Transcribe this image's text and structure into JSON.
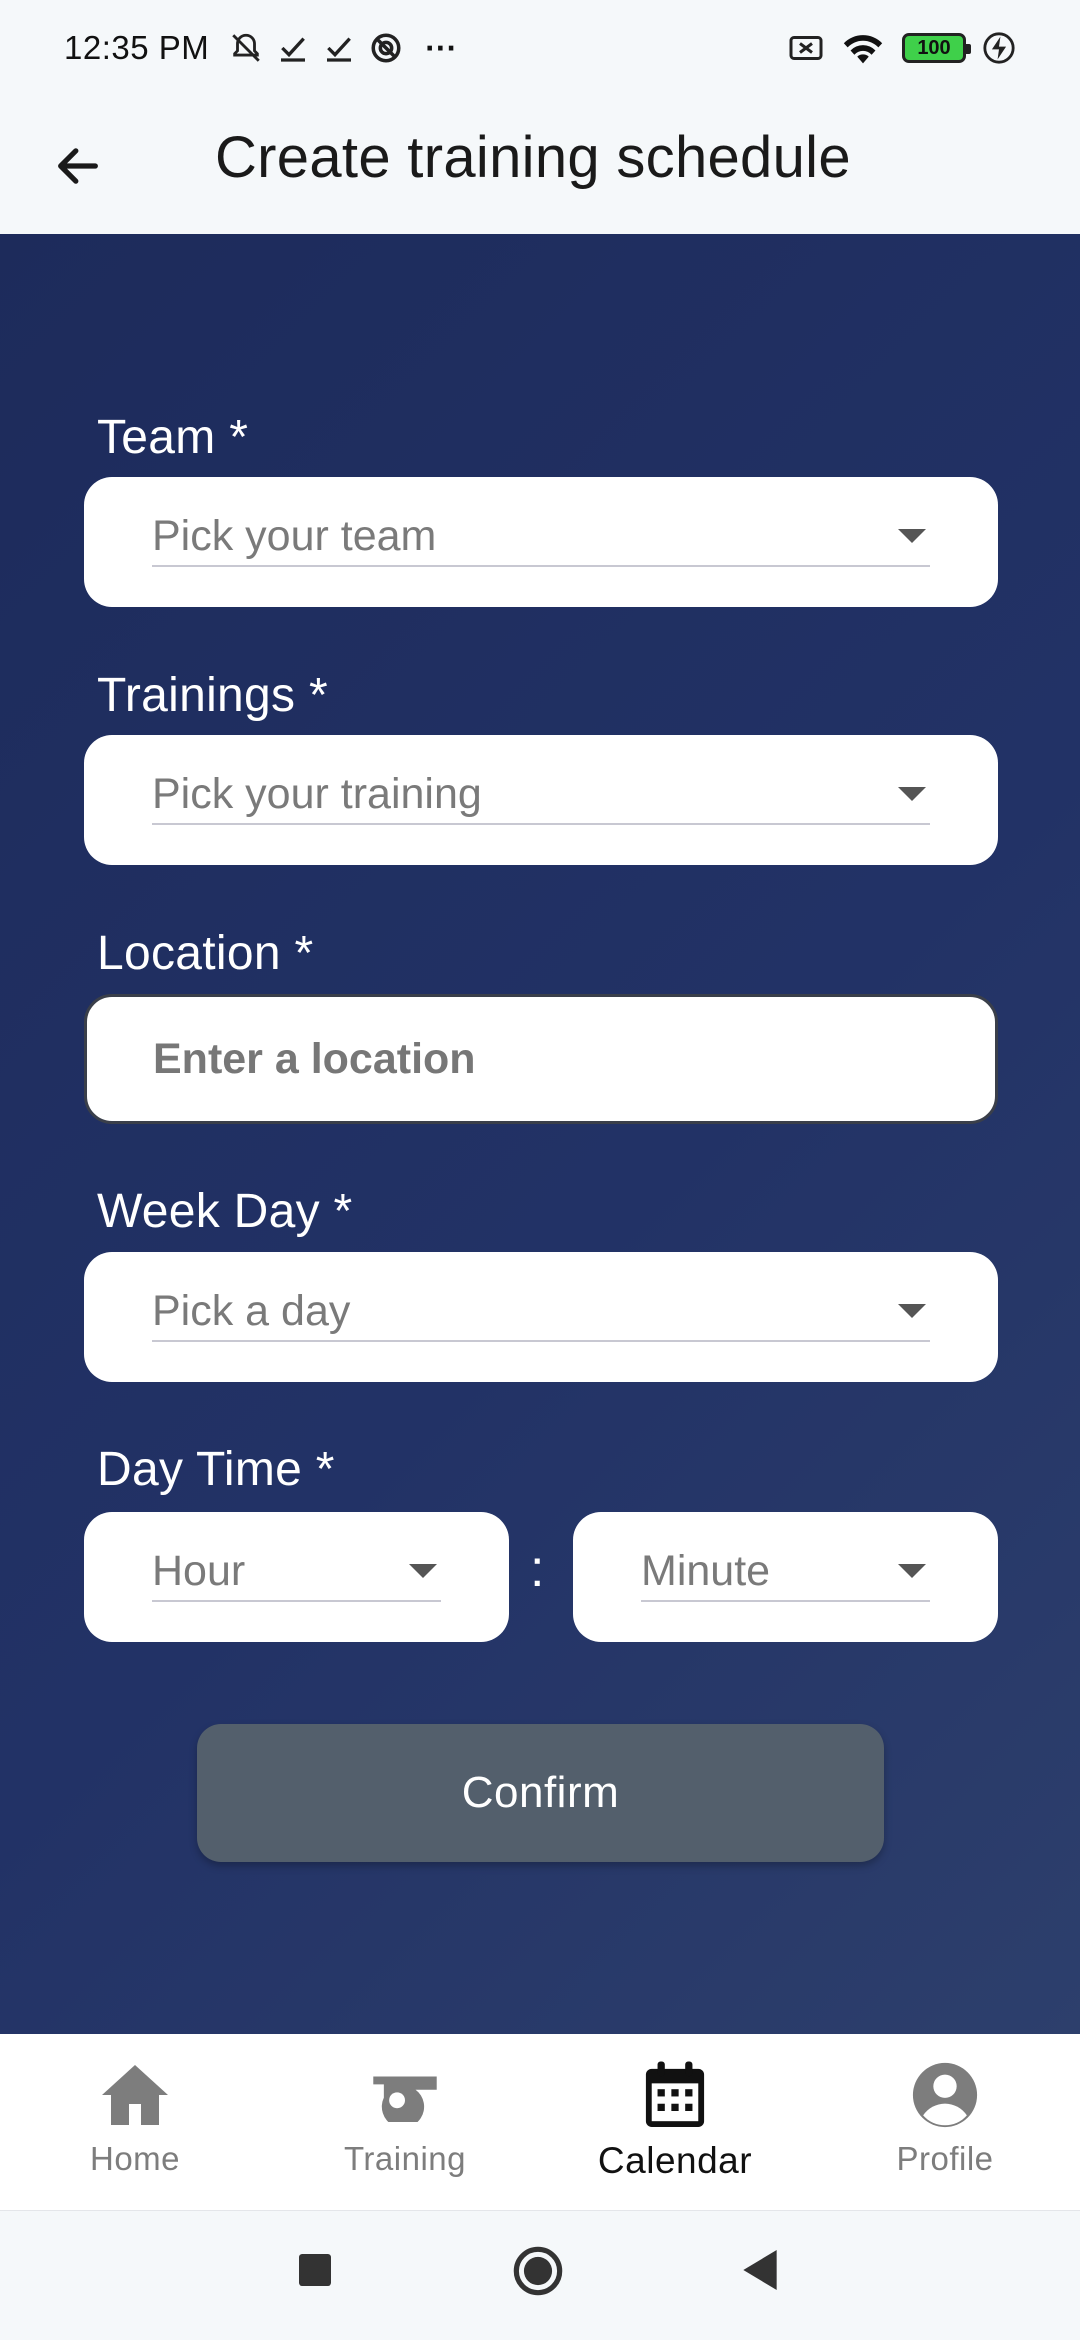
{
  "status_bar": {
    "time": "12:35 PM",
    "more": "···",
    "battery": "100"
  },
  "app_bar": {
    "title": "Create training schedule"
  },
  "form": {
    "team": {
      "label": "Team *",
      "placeholder": "Pick your team"
    },
    "training": {
      "label": "Trainings *",
      "placeholder": "Pick your training"
    },
    "location": {
      "label": "Location *",
      "placeholder": "Enter a location"
    },
    "week_day": {
      "label": "Week Day *",
      "placeholder": "Pick a day"
    },
    "day_time": {
      "label": "Day Time *",
      "hour_placeholder": "Hour",
      "minute_placeholder": "Minute",
      "separator": ":"
    },
    "confirm_label": "Confirm"
  },
  "bottom_nav": {
    "items": [
      {
        "label": "Home",
        "icon": "home-icon"
      },
      {
        "label": "Training",
        "icon": "whistle-icon"
      },
      {
        "label": "Calendar",
        "icon": "calendar-icon",
        "active": true
      },
      {
        "label": "Profile",
        "icon": "profile-icon"
      }
    ]
  },
  "colors": {
    "background_gradient_start": "#1d2b5b",
    "background_gradient_end": "#2d3f6c",
    "confirm_button": "#535f6c",
    "nav_active": "#111111",
    "nav_inactive": "#7d7d7d"
  }
}
